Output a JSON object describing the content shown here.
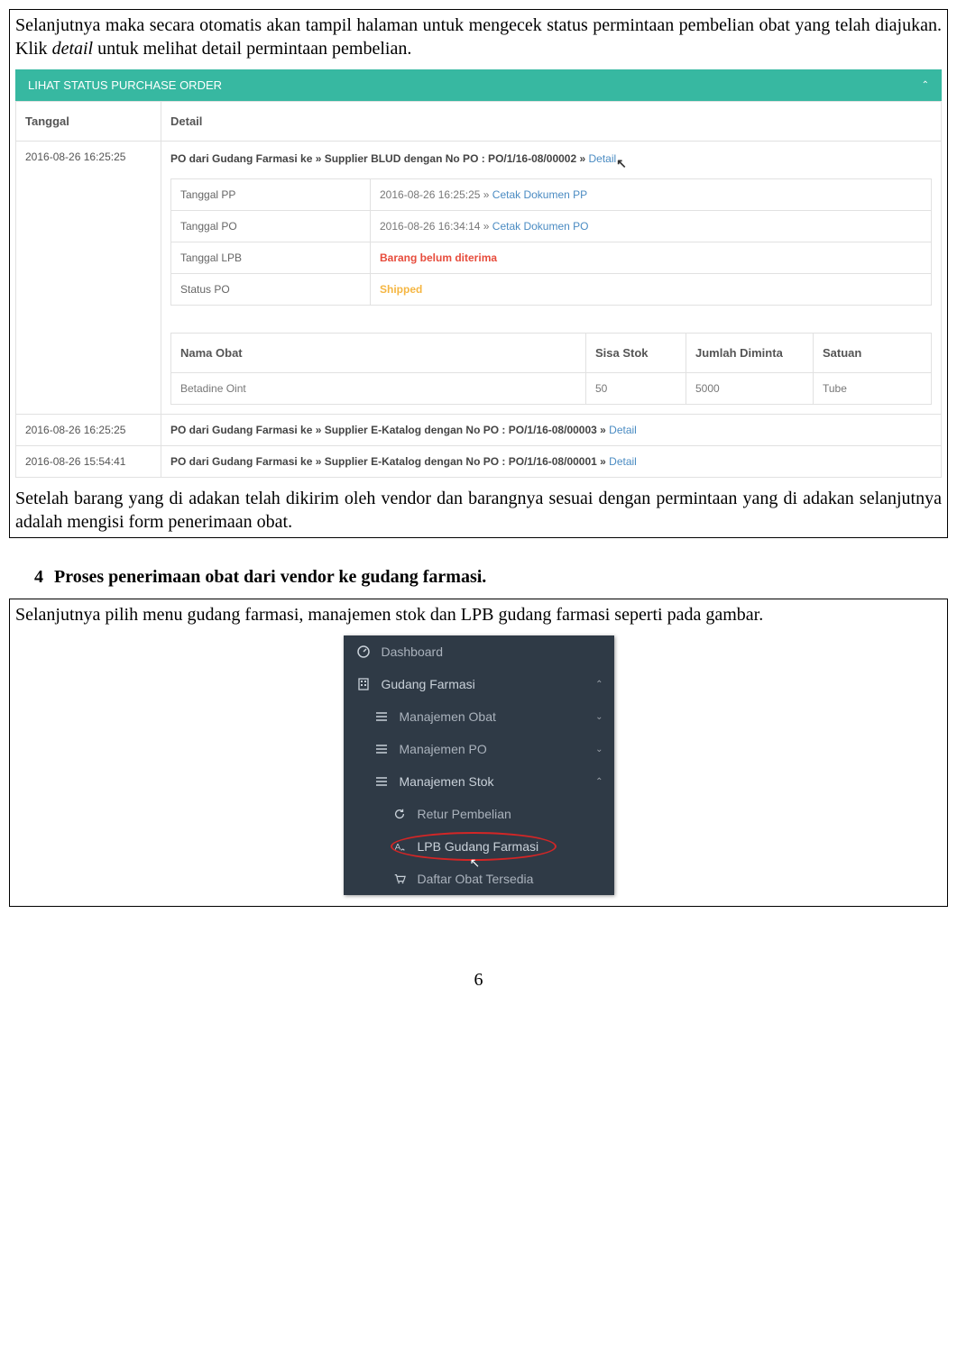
{
  "intro_paragraph_1": "Selanjutnya maka secara otomatis akan tampil halaman untuk mengecek status permintaan pembelian obat yang telah diajukan. Klik ",
  "intro_detail_word": "detail",
  "intro_paragraph_2": " untuk melihat detail permintaan pembelian.",
  "panel_title": "LIHAT STATUS PURCHASE ORDER",
  "table_headers": {
    "date": "Tanggal",
    "detail": "Detail"
  },
  "rows": [
    {
      "date": "2016-08-26 16:25:25",
      "title_prefix": "PO dari Gudang Farmasi ke » Supplier BLUD dengan No PO : PO/1/16-08/00002 » ",
      "detail_link": "Detail",
      "details": {
        "tanggal_pp_label": "Tanggal PP",
        "tanggal_pp_value": "2016-08-26 16:25:25 » ",
        "tanggal_pp_link": "Cetak Dokumen PP",
        "tanggal_po_label": "Tanggal PO",
        "tanggal_po_value": "2016-08-26 16:34:14 » ",
        "tanggal_po_link": "Cetak Dokumen PO",
        "tanggal_lpb_label": "Tanggal LPB",
        "tanggal_lpb_value": "Barang belum diterima",
        "status_label": "Status PO",
        "status_value": "Shipped"
      },
      "drug_headers": {
        "name": "Nama Obat",
        "stock": "Sisa Stok",
        "qty": "Jumlah Diminta",
        "unit": "Satuan"
      },
      "drugs": [
        {
          "name": "Betadine Oint",
          "stock": "50",
          "qty": "5000",
          "unit": "Tube"
        }
      ]
    },
    {
      "date": "2016-08-26 16:25:25",
      "title_prefix": "PO dari Gudang Farmasi ke » Supplier E-Katalog dengan No PO : PO/1/16-08/00003 » ",
      "detail_link": "Detail"
    },
    {
      "date": "2016-08-26 15:54:41",
      "title_prefix": "PO dari Gudang Farmasi ke » Supplier E-Katalog dengan No PO : PO/1/16-08/00001 » ",
      "detail_link": "Detail"
    }
  ],
  "after_panel_paragraph": "Setelah barang yang di adakan telah dikirim oleh vendor dan barangnya sesuai dengan permintaan yang di adakan selanjutnya adalah mengisi form penerimaan obat.",
  "section_number": "4",
  "section_title": "Proses penerimaan obat dari vendor ke gudang farmasi.",
  "second_block_text": "Selanjutnya pilih menu gudang farmasi, manajemen stok dan LPB gudang farmasi seperti pada gambar.",
  "menu": {
    "dashboard": "Dashboard",
    "gudang": "Gudang Farmasi",
    "manajemen_obat": "Manajemen Obat",
    "manajemen_po": "Manajemen PO",
    "manajemen_stok": "Manajemen Stok",
    "retur": "Retur Pembelian",
    "lpb": "LPB Gudang Farmasi",
    "daftar": "Daftar Obat Tersedia"
  },
  "page_number": "6"
}
